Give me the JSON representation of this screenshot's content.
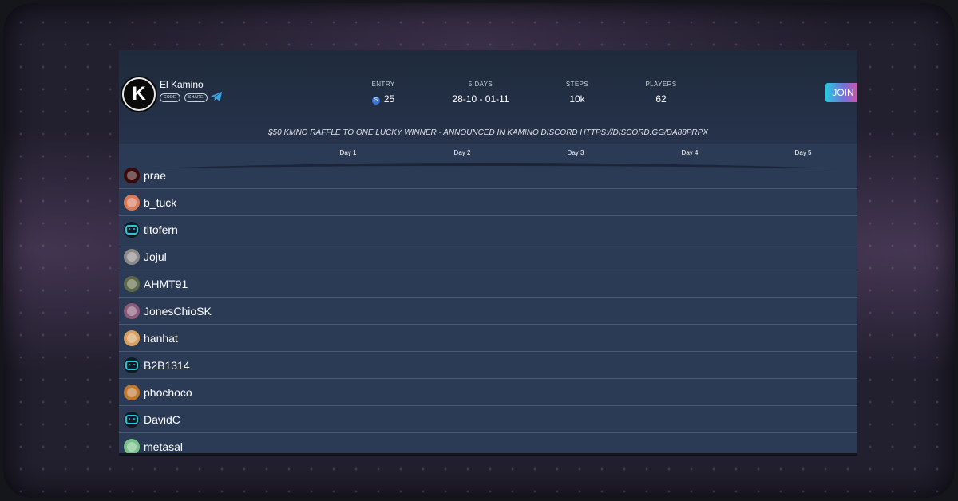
{
  "header": {
    "logo_letter": "K",
    "team_name": "El Kamino",
    "code_label": "CODE",
    "share_label": "SHARE",
    "stats": [
      {
        "label": "ENTRY",
        "value": "25",
        "icon": "coin-icon"
      },
      {
        "label": "5 DAYS",
        "value": "28-10 - 01-11"
      },
      {
        "label": "STEPS",
        "value": "10k"
      },
      {
        "label": "PLAYERS",
        "value": "62"
      }
    ],
    "join_label": "JOIN",
    "coin_glyph": "S"
  },
  "banner": "$50 KMNO RAFFLE TO ONE LUCKY WINNER - ANNOUNCED IN KAMINO DISCORD HTTPS://DISCORD.GG/DA88PRPX",
  "days": [
    "Day 1",
    "Day 2",
    "Day 3",
    "Day 4",
    "Day 5"
  ],
  "players": [
    {
      "name": "prae",
      "avatar": "red-demon-avatar",
      "color": "#3a0a0a"
    },
    {
      "name": "b_tuck",
      "avatar": "badge-avatar",
      "color": "#d77a5a"
    },
    {
      "name": "titofern",
      "avatar": "bot-avatar",
      "color": "#0f1a24"
    },
    {
      "name": "Jojul",
      "avatar": "photo-avatar",
      "color": "#8a8a8a"
    },
    {
      "name": "AHMT91",
      "avatar": "photo-avatar",
      "color": "#5e6a4a"
    },
    {
      "name": "JonesChioSK",
      "avatar": "photo-avatar",
      "color": "#8a5a7a"
    },
    {
      "name": "hanhat",
      "avatar": "dog-avatar",
      "color": "#d8a060"
    },
    {
      "name": "B2B1314",
      "avatar": "bot-avatar",
      "color": "#0f1a24"
    },
    {
      "name": "phochoco",
      "avatar": "monkey-avatar",
      "color": "#c07830"
    },
    {
      "name": "DavidC",
      "avatar": "bot-avatar",
      "color": "#0f1a24"
    },
    {
      "name": "metasal",
      "avatar": "green-avatar",
      "color": "#7ac08a"
    }
  ],
  "colors": {
    "card_bg": "#2b3a55",
    "row_divider": "#4a5a76",
    "accent_cyan": "#27c9e0",
    "accent_pink": "#e0509e"
  }
}
